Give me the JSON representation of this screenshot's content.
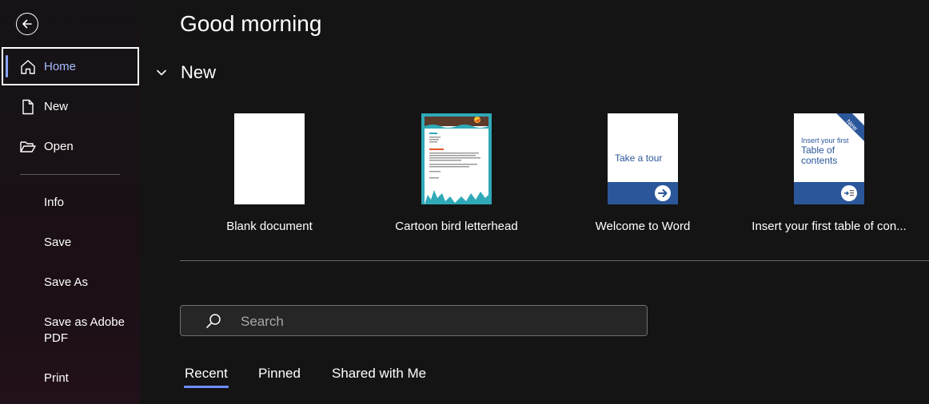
{
  "sidebar": {
    "items": [
      {
        "label": "Home",
        "icon": "home-icon",
        "selected": true
      },
      {
        "label": "New",
        "icon": "new-document-icon"
      },
      {
        "label": "Open",
        "icon": "open-folder-icon"
      },
      {
        "label": "Info"
      },
      {
        "label": "Save"
      },
      {
        "label": "Save As"
      },
      {
        "label": "Save as Adobe PDF"
      },
      {
        "label": "Print"
      }
    ]
  },
  "main": {
    "greeting": "Good morning",
    "new_section": {
      "title": "New",
      "templates": [
        {
          "label": "Blank document"
        },
        {
          "label": "Cartoon bird letterhead"
        },
        {
          "label": "Welcome to Word",
          "thumb_text": "Take a tour"
        },
        {
          "label": "Insert your first table of con...",
          "thumb_text_1": "Insert your first",
          "thumb_text_2": "Table of contents",
          "badge": "New"
        }
      ]
    },
    "search": {
      "placeholder": "Search"
    },
    "tabs": [
      {
        "label": "Recent",
        "active": true
      },
      {
        "label": "Pinned"
      },
      {
        "label": "Shared with Me"
      }
    ]
  },
  "colors": {
    "accent": "#6d8dff",
    "template_blue": "#2b579a"
  }
}
